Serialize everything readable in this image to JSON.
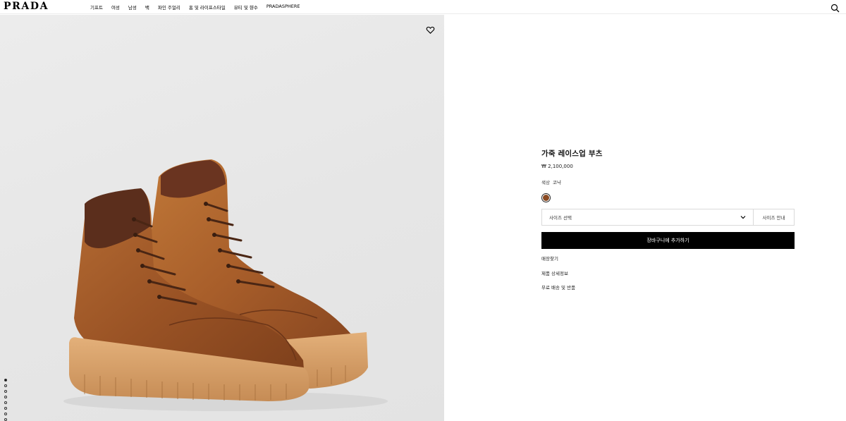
{
  "header": {
    "logo": "PRADA",
    "nav": [
      "기프트",
      "여성",
      "남성",
      "백",
      "파인 주얼리",
      "홈 및 라이프스타일",
      "뷰티 및 향수",
      "PRADASPHERE"
    ]
  },
  "gallery": {
    "slide_count": 8,
    "active_slide": 1
  },
  "product": {
    "title": "가죽 레이스업 부츠",
    "price": "₩ 2,100,000",
    "color_label": "색상",
    "color_value": "코냑",
    "swatch_color": "#8a4a22",
    "size_select_placeholder": "사이즈 선택",
    "size_guide_label": "사이즈 안내",
    "add_to_cart_label": "장바구니에 추가하기",
    "links": [
      "매장찾기",
      "제품 상세정보",
      "무료 배송 및 반품"
    ]
  },
  "colors": {
    "accent": "#000000",
    "leather": "#a65f2c",
    "collar": "#5b2e1c",
    "sole": "#d7a06b"
  }
}
